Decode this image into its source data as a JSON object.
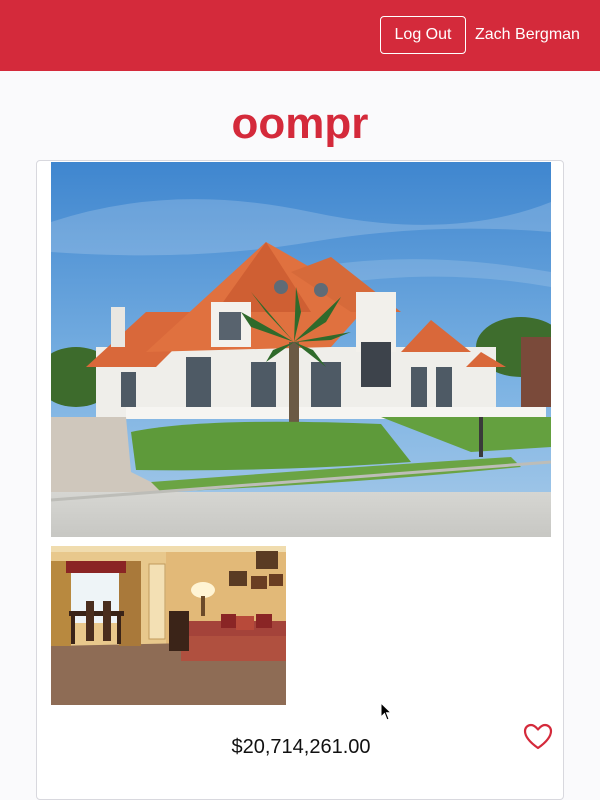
{
  "header": {
    "logout_label": "Log Out",
    "user_name": "Zach Bergman",
    "brand_color": "#d42a3b"
  },
  "app": {
    "title": "oompr"
  },
  "listing": {
    "price": "$20,714,261.00",
    "favorite_icon": "heart-outline-icon",
    "main_image": "house-exterior-photo",
    "thumbnail_image": "living-room-photo"
  }
}
